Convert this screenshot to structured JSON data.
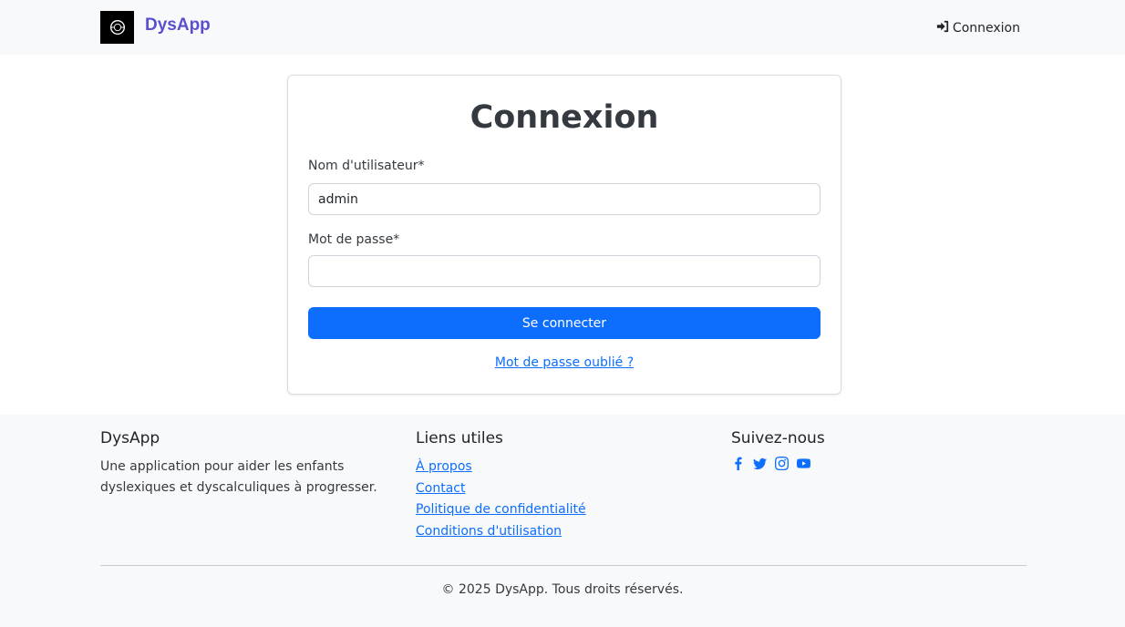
{
  "navbar": {
    "brand": "DysApp",
    "logo_icon": "dys-logo-icon",
    "login_link": "Connexion",
    "login_icon": "sign-in-icon"
  },
  "login_form": {
    "title": "Connexion",
    "username_label": "Nom d'utilisateur*",
    "username_value": "admin",
    "password_label": "Mot de passe*",
    "password_value": "",
    "submit_label": "Se connecter",
    "forgot_link": "Mot de passe oublié ?"
  },
  "footer": {
    "about": {
      "heading": "DysApp",
      "description": "Une application pour aider les enfants dyslexiques et dyscalculiques à progresser."
    },
    "links": {
      "heading": "Liens utiles",
      "items": [
        "À propos",
        "Contact",
        "Politique de confidentialité",
        "Conditions d'utilisation"
      ]
    },
    "social": {
      "heading": "Suivez-nous",
      "icons": [
        "facebook-icon",
        "twitter-icon",
        "instagram-icon",
        "youtube-icon"
      ]
    },
    "copyright": "© 2025 DysApp. Tous droits réservés."
  },
  "colors": {
    "primary": "#0d6efd",
    "brand": "#5a4fcf",
    "background_light": "#f8f9fa"
  }
}
